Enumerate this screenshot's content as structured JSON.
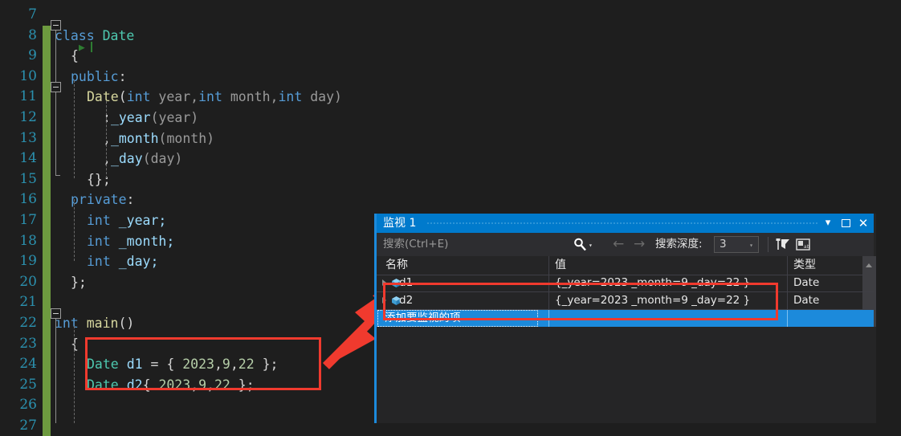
{
  "editor": {
    "lines": [
      {
        "num": "7",
        "changed": false,
        "tokens": []
      },
      {
        "num": "8",
        "changed": true,
        "tokens": [
          {
            "t": "class ",
            "c": "kw"
          },
          {
            "t": "Date",
            "c": "ty"
          }
        ],
        "indent": 0
      },
      {
        "num": "9",
        "changed": true,
        "tokens": [
          {
            "t": "{",
            "c": "brc"
          }
        ],
        "indent": 1,
        "run_marker": true
      },
      {
        "num": "10",
        "changed": true,
        "tokens": [
          {
            "t": "public",
            "c": "kw"
          },
          {
            "t": ":",
            "c": "pun"
          }
        ],
        "indent": 1
      },
      {
        "num": "11",
        "changed": true,
        "tokens": [
          {
            "t": "Date",
            "c": "fn"
          },
          {
            "t": "(",
            "c": "pun"
          },
          {
            "t": "int",
            "c": "kw"
          },
          {
            "t": " year,",
            "c": "pl"
          },
          {
            "t": "int",
            "c": "kw"
          },
          {
            "t": " month,",
            "c": "pl"
          },
          {
            "t": "int",
            "c": "kw"
          },
          {
            "t": " day)",
            "c": "pl"
          }
        ],
        "indent": 2
      },
      {
        "num": "12",
        "changed": true,
        "tokens": [
          {
            "t": ":",
            "c": "pun"
          },
          {
            "t": "_year",
            "c": "id"
          },
          {
            "t": "(year)",
            "c": "pl"
          }
        ],
        "indent": 3
      },
      {
        "num": "13",
        "changed": true,
        "tokens": [
          {
            "t": ",",
            "c": "pun"
          },
          {
            "t": "_month",
            "c": "id"
          },
          {
            "t": "(month)",
            "c": "pl"
          }
        ],
        "indent": 3
      },
      {
        "num": "14",
        "changed": true,
        "tokens": [
          {
            "t": ",",
            "c": "pun"
          },
          {
            "t": "_day",
            "c": "id"
          },
          {
            "t": "(day)",
            "c": "pl"
          }
        ],
        "indent": 3
      },
      {
        "num": "15",
        "changed": true,
        "tokens": [
          {
            "t": "{};",
            "c": "brc"
          }
        ],
        "indent": 2
      },
      {
        "num": "16",
        "changed": true,
        "tokens": [
          {
            "t": "private",
            "c": "kw"
          },
          {
            "t": ":",
            "c": "pun"
          }
        ],
        "indent": 1
      },
      {
        "num": "17",
        "changed": true,
        "tokens": [
          {
            "t": "int",
            "c": "kw"
          },
          {
            "t": " ",
            "c": "pun"
          },
          {
            "t": "_year;",
            "c": "id"
          }
        ],
        "indent": 2
      },
      {
        "num": "18",
        "changed": true,
        "tokens": [
          {
            "t": "int",
            "c": "kw"
          },
          {
            "t": " ",
            "c": "pun"
          },
          {
            "t": "_month;",
            "c": "id"
          }
        ],
        "indent": 2
      },
      {
        "num": "19",
        "changed": true,
        "tokens": [
          {
            "t": "int",
            "c": "kw"
          },
          {
            "t": " ",
            "c": "pun"
          },
          {
            "t": "_day;",
            "c": "id"
          }
        ],
        "indent": 2
      },
      {
        "num": "20",
        "changed": true,
        "tokens": [
          {
            "t": "};",
            "c": "brc"
          }
        ],
        "indent": 1
      },
      {
        "num": "21",
        "changed": true,
        "tokens": []
      },
      {
        "num": "22",
        "changed": true,
        "tokens": [
          {
            "t": "int",
            "c": "kw"
          },
          {
            "t": " ",
            "c": "pun"
          },
          {
            "t": "main",
            "c": "fn"
          },
          {
            "t": "()",
            "c": "pun"
          }
        ],
        "indent": 0
      },
      {
        "num": "23",
        "changed": true,
        "tokens": [
          {
            "t": "{",
            "c": "brc"
          }
        ],
        "indent": 1
      },
      {
        "num": "24",
        "changed": true,
        "tokens": [
          {
            "t": "Date",
            "c": "ty"
          },
          {
            "t": " ",
            "c": "pun"
          },
          {
            "t": "d1",
            "c": "id"
          },
          {
            "t": " = { ",
            "c": "pun"
          },
          {
            "t": "2023",
            "c": "num"
          },
          {
            "t": ",",
            "c": "pun"
          },
          {
            "t": "9",
            "c": "num"
          },
          {
            "t": ",",
            "c": "pun"
          },
          {
            "t": "22",
            "c": "num"
          },
          {
            "t": " };",
            "c": "pun"
          }
        ],
        "indent": 2
      },
      {
        "num": "25",
        "changed": true,
        "tokens": [
          {
            "t": "Date",
            "c": "ty"
          },
          {
            "t": " ",
            "c": "pun"
          },
          {
            "t": "d2",
            "c": "id"
          },
          {
            "t": "{ ",
            "c": "pun"
          },
          {
            "t": "2023",
            "c": "num"
          },
          {
            "t": ",",
            "c": "pun"
          },
          {
            "t": "9",
            "c": "num"
          },
          {
            "t": ",",
            "c": "pun"
          },
          {
            "t": "22",
            "c": "num"
          },
          {
            "t": " };",
            "c": "pun"
          }
        ],
        "indent": 2
      },
      {
        "num": "26",
        "changed": true,
        "tokens": []
      },
      {
        "num": "27",
        "changed": true,
        "tokens": []
      }
    ]
  },
  "watch": {
    "title": "监视 1",
    "buttons": {
      "dropdown": "▾",
      "maximize": "maximize-icon",
      "close": "✕"
    },
    "toolbar": {
      "search_placeholder": "搜索(Ctrl+E)",
      "search_icon": "search-icon",
      "search_dropdown": "▾",
      "nav_back": "←",
      "nav_forward": "→",
      "depth_label": "搜索深度:",
      "depth_value": "3",
      "depth_arrow": "▾",
      "pin_icon": "pin-filter-icon",
      "hex_icon": "hex-display-icon"
    },
    "columns": [
      {
        "label": "名称"
      },
      {
        "label": "值"
      },
      {
        "label": "类型"
      }
    ],
    "rows": [
      {
        "name": "d1",
        "value": "{_year=2023 _month=9 _day=22 }",
        "type": "Date",
        "icon": "cube-icon",
        "expander": "▸"
      },
      {
        "name": "d2",
        "value": "{_year=2023 _month=9 _day=22 }",
        "type": "Date",
        "icon": "cube-icon",
        "expander": "▸"
      }
    ],
    "add_row_placeholder": "添加要监视的项"
  },
  "annotations": {
    "accent_red": "#f03a2e",
    "accent_blue": "#007acc",
    "change_bar_green": "#6d9a3f"
  }
}
